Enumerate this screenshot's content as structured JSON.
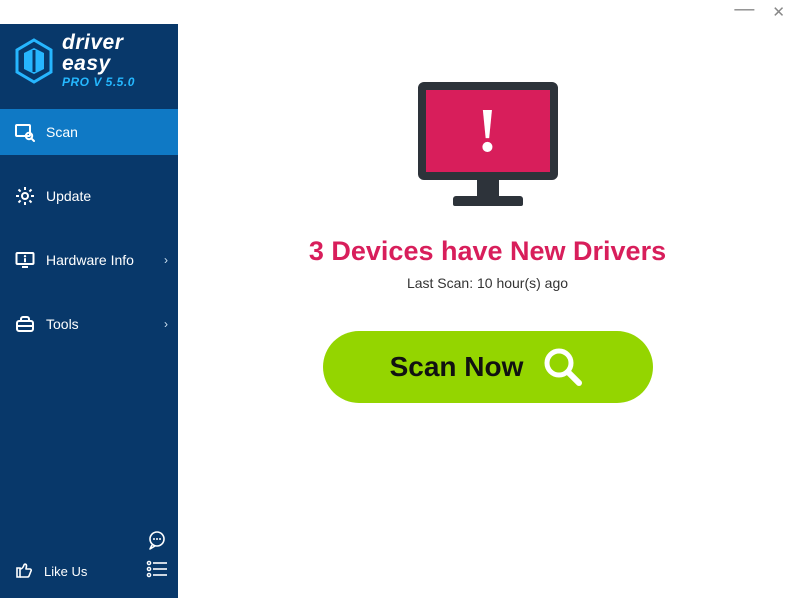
{
  "brand": {
    "name": "driver easy",
    "version": "PRO V 5.5.0"
  },
  "sidebar": {
    "items": [
      {
        "label": "Scan"
      },
      {
        "label": "Update"
      },
      {
        "label": "Hardware Info"
      },
      {
        "label": "Tools"
      }
    ],
    "like_label": "Like Us"
  },
  "main": {
    "headline": "3 Devices have New Drivers",
    "last_scan": "Last Scan: 10 hour(s) ago",
    "scan_button": "Scan Now"
  },
  "colors": {
    "sidebar_bg": "#08386a",
    "sidebar_active": "#0f79c5",
    "accent_blue": "#25b8ff",
    "scan_green": "#94d500",
    "alert_pink": "#d81e5b"
  }
}
